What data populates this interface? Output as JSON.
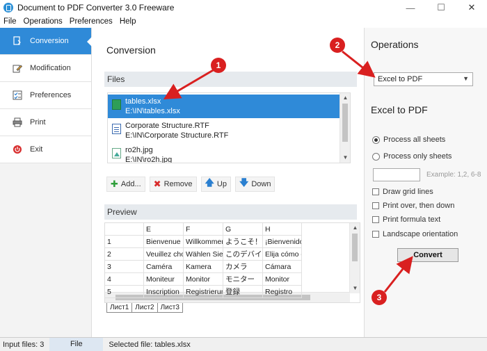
{
  "window": {
    "title": "Document to PDF Converter 3.0 Freeware",
    "controls": [
      "—",
      "☐",
      "✕"
    ]
  },
  "menu": [
    "File",
    "Operations",
    "Preferences",
    "Help"
  ],
  "sidebar": {
    "items": [
      {
        "label": "Conversion",
        "icon": "conversion-icon",
        "active": true
      },
      {
        "label": "Modification",
        "icon": "pencil-icon",
        "active": false
      },
      {
        "label": "Preferences",
        "icon": "checklist-icon",
        "active": false
      },
      {
        "label": "Print",
        "icon": "printer-icon",
        "active": false
      },
      {
        "label": "Exit",
        "icon": "power-icon",
        "active": false
      }
    ]
  },
  "main": {
    "title": "Conversion",
    "files_header": "Files",
    "files": [
      {
        "name": "tables.xlsx",
        "path": "E:\\IN\\tables.xlsx",
        "icon": "excel-file-icon",
        "selected": true
      },
      {
        "name": "Corporate Structure.RTF",
        "path": "E:\\IN\\Corporate Structure.RTF",
        "icon": "document-file-icon",
        "selected": false
      },
      {
        "name": "ro2h.jpg",
        "path": "E:\\IN\\ro2h.jpg",
        "icon": "image-file-icon",
        "selected": false
      }
    ],
    "actions": [
      {
        "label": "Add...",
        "icon": "plus-icon",
        "color": "#2e9e3a"
      },
      {
        "label": "Remove",
        "icon": "x-icon",
        "color": "#d82a2a"
      },
      {
        "label": "Up",
        "icon": "arrow-up-icon",
        "color": "#2a7fd0"
      },
      {
        "label": "Down",
        "icon": "arrow-down-icon",
        "color": "#2a7fd0"
      }
    ],
    "preview_header": "Preview",
    "preview": {
      "columns": [
        "",
        "E",
        "F",
        "G",
        "H"
      ],
      "rows": [
        [
          "1",
          "Bienvenue !",
          "Willkommen!",
          "ようこそ！",
          "¡Bienvenido!"
        ],
        [
          "2",
          "Veuillez chois",
          "Wählen Sie a",
          "このデバイスの",
          "Elija cómo cor"
        ],
        [
          "3",
          "Caméra",
          "Kamera",
          "カメラ",
          "Cámara"
        ],
        [
          "4",
          "Moniteur",
          "Monitor",
          "モニター",
          "Monitor"
        ],
        [
          "5",
          "Inscription",
          "Registrierunc",
          "登録",
          "Registro"
        ]
      ]
    },
    "sheets": [
      "Лист1",
      "Лист2",
      "Лист3"
    ]
  },
  "operations": {
    "title": "Operations",
    "selected": "Excel to PDF",
    "subtitle": "Excel to PDF",
    "radios": [
      {
        "label": "Process all sheets",
        "checked": true
      },
      {
        "label": "Process only sheets",
        "checked": false
      }
    ],
    "pages_value": "",
    "pages_hint": "Example: 1,2, 6-8",
    "checkboxes": [
      {
        "label": "Draw grid lines",
        "checked": false
      },
      {
        "label": "Print over, then down",
        "checked": false
      },
      {
        "label": "Print formula text",
        "checked": false
      },
      {
        "label": "Landscape orientation",
        "checked": false
      }
    ],
    "convert_label": "Convert"
  },
  "status": {
    "input_files": "Input files: 3",
    "tab": "File",
    "selected": "Selected file: tables.xlsx"
  },
  "annotations": {
    "badges": [
      "1",
      "2",
      "3"
    ],
    "color": "#d92020"
  }
}
